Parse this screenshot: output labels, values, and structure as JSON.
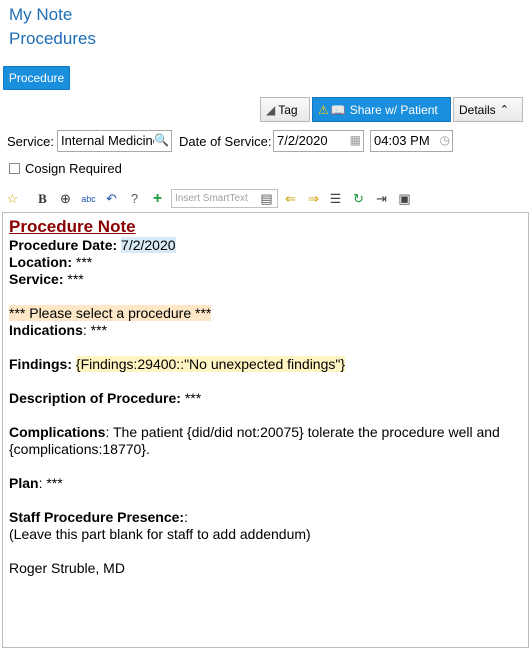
{
  "header": {
    "title_line1": "My Note",
    "title_line2": "Procedures"
  },
  "procedure_button": "Procedure",
  "toolbar": {
    "tag": "Tag",
    "share": "Share w/ Patient",
    "details": "Details"
  },
  "service": {
    "label": "Service:",
    "value": "Internal Medicine",
    "date_label": "Date of Service:",
    "date_value": "7/2/2020",
    "time_value": "04:03 PM"
  },
  "cosign": {
    "label": "Cosign Required",
    "checked": false
  },
  "editor_toolbar": {
    "smarttext_placeholder": "Insert SmartText"
  },
  "note": {
    "title": "Procedure Note",
    "procedure_date_label": "Procedure Date:",
    "procedure_date_value": "7/2/2020",
    "location_label": "Location:",
    "location_value": "***",
    "service_label": "Service:",
    "service_value": "***",
    "select_procedure": "*** Please select a procedure ***",
    "indications_label": "Indications",
    "indications_value": ": ***",
    "findings_label": "Findings:",
    "findings_value": "{Findings:29400::\"No unexpected findings\"}",
    "description_label": "Description of Procedure:",
    "description_value": "***",
    "complications_label": "Complications",
    "complications_value": ":  The patient {did/did not:20075} tolerate the procedure well and {complications:18770}.",
    "plan_label": "Plan",
    "plan_value": ": ***",
    "staff_label": "Staff Procedure Presence:",
    "staff_colon": ":",
    "staff_note": "(Leave this part blank for staff to add addendum)",
    "signature": "Roger Struble, MD"
  }
}
